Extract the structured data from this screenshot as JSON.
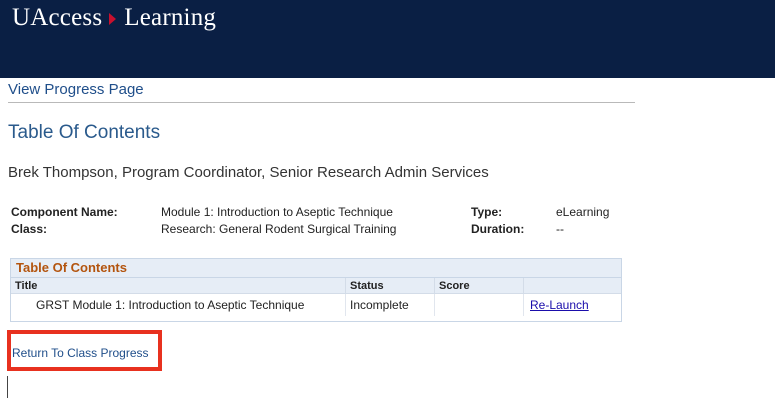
{
  "header": {
    "brand_part1": "UAccess",
    "brand_part2": "Learning"
  },
  "nav": {
    "view_progress_link": "View Progress Page"
  },
  "page": {
    "heading": "Table Of Contents",
    "person_line": "Brek Thompson, Program Coordinator, Senior Research Admin Services"
  },
  "meta": {
    "component_name_label": "Component Name:",
    "component_name_value": "Module 1: Introduction to Aseptic Technique",
    "type_label": "Type:",
    "type_value": "eLearning",
    "class_label": "Class:",
    "class_value": "Research: General Rodent Surgical Training",
    "duration_label": "Duration:",
    "duration_value": "--"
  },
  "toc": {
    "caption": "Table Of Contents",
    "columns": [
      "Title",
      "Status",
      "Score",
      ""
    ],
    "rows": [
      {
        "title": "GRST Module 1: Introduction to Aseptic Technique",
        "status": "Incomplete",
        "score": "",
        "action": "Re-Launch"
      }
    ]
  },
  "footer": {
    "return_link": "Return To Class Progress"
  },
  "colors": {
    "header_bg": "#0a1f44",
    "accent_red": "#c8102e",
    "highlight_box": "#e8311f",
    "link_blue": "#1f4e8a",
    "toc_caption": "#b3540e"
  }
}
